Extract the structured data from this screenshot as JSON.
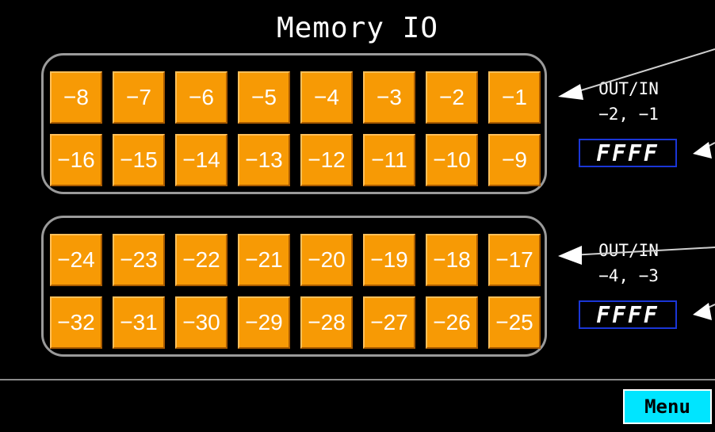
{
  "title": "Memory IO",
  "group1": {
    "row1": [
      "−8",
      "−7",
      "−6",
      "−5",
      "−4",
      "−3",
      "−2",
      "−1"
    ],
    "row2": [
      "−16",
      "−15",
      "−14",
      "−13",
      "−12",
      "−11",
      "−10",
      "−9"
    ],
    "label_line1": "OUT/IN",
    "label_line2": "−2, −1",
    "display": "FFFF"
  },
  "group2": {
    "row1": [
      "−24",
      "−23",
      "−22",
      "−21",
      "−20",
      "−19",
      "−18",
      "−17"
    ],
    "row2": [
      "−32",
      "−31",
      "−30",
      "−29",
      "−28",
      "−27",
      "−26",
      "−25"
    ],
    "label_line1": "OUT/IN",
    "label_line2": "−4, −3",
    "display": "FFFF"
  },
  "menu_label": "Menu",
  "colors": {
    "button": "#f79a05",
    "menu": "#00e5ff",
    "display_border": "#1a36d6",
    "background": "#000000"
  }
}
